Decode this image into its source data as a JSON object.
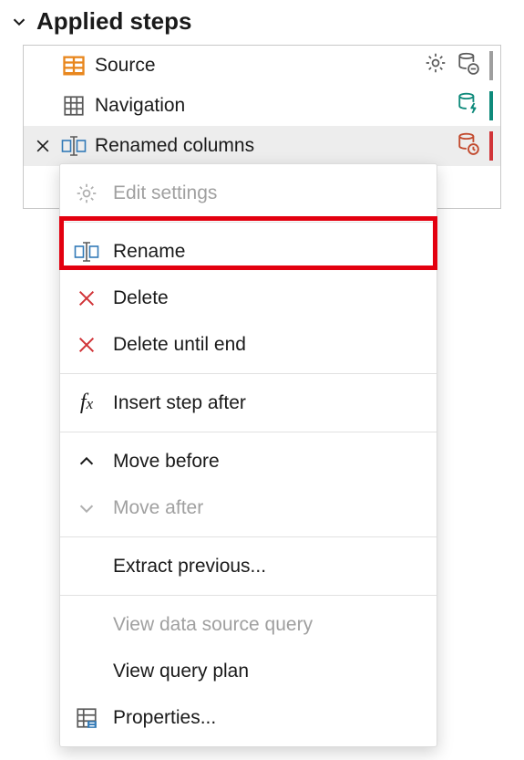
{
  "header": {
    "title": "Applied steps"
  },
  "steps": [
    {
      "label": "Source"
    },
    {
      "label": "Navigation"
    },
    {
      "label": "Renamed columns"
    }
  ],
  "menu": {
    "editSettings": "Edit settings",
    "rename": "Rename",
    "delete": "Delete",
    "deleteUntilEnd": "Delete until end",
    "insertStepAfter": "Insert step after",
    "moveBefore": "Move before",
    "moveAfter": "Move after",
    "extractPrevious": "Extract previous...",
    "viewDataSourceQuery": "View data source query",
    "viewQueryPlan": "View query plan",
    "properties": "Properties..."
  }
}
